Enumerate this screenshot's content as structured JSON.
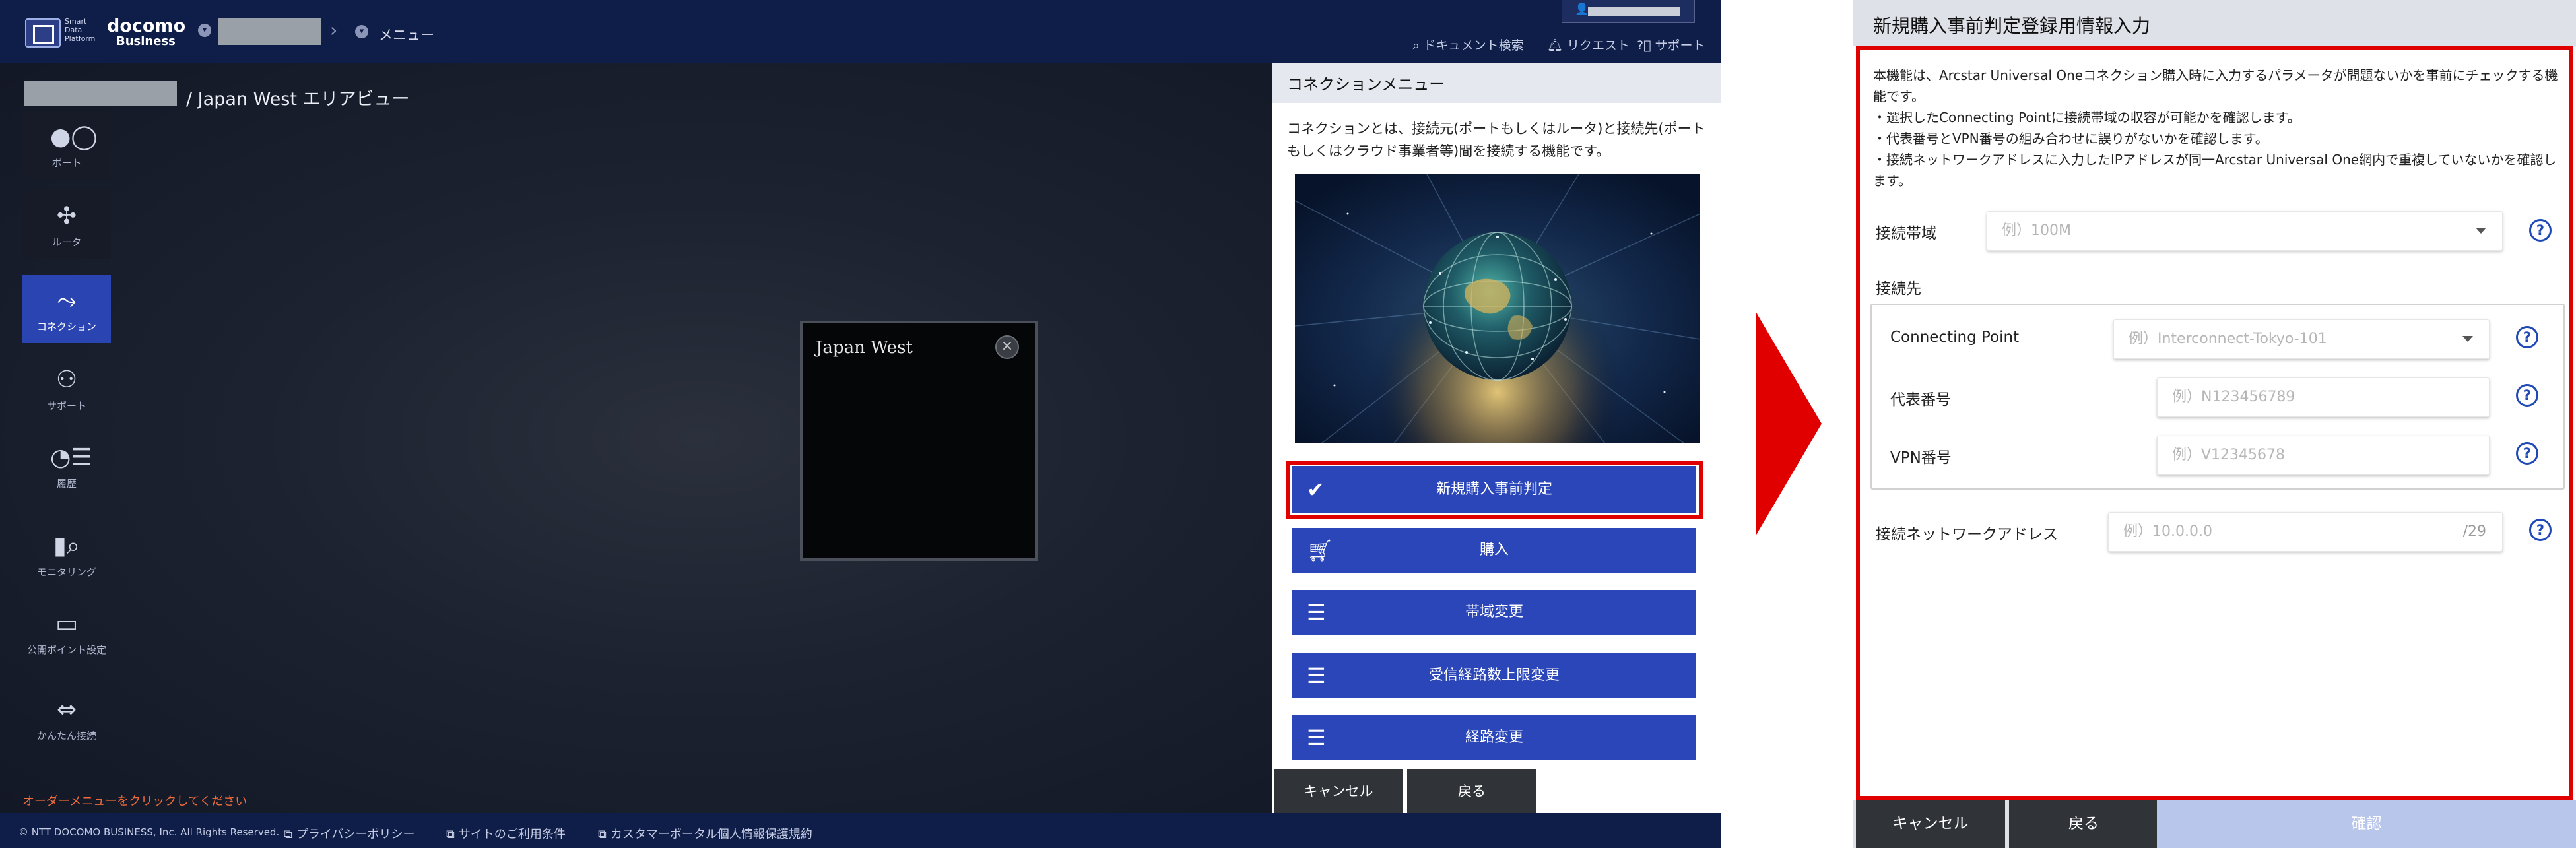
{
  "left": {
    "header": {
      "brand_small": "Smart Data Platform",
      "brand_name": "docomo",
      "brand_sub": "Business",
      "menu_label": "メニュー",
      "links": [
        {
          "label": "ドキュメント検索",
          "icon": "search-icon"
        },
        {
          "label": "リクエスト",
          "icon": "bell-icon"
        },
        {
          "label": "サポート",
          "icon": "help-icon"
        }
      ]
    },
    "area_title": "/ Japan West エリアビュー",
    "sidebar": [
      {
        "label": "ポート",
        "icon": "port-icon"
      },
      {
        "label": "ルータ",
        "icon": "router-icon"
      },
      {
        "label": "コネクション",
        "icon": "connection-icon",
        "active": true
      },
      {
        "label": "サポート",
        "icon": "support-icon"
      },
      {
        "label": "履歴",
        "icon": "history-icon"
      },
      {
        "label": "モニタリング",
        "icon": "monitoring-icon"
      },
      {
        "label": "公開ポイント設定",
        "icon": "public-point-icon"
      },
      {
        "label": "かんたん接続",
        "icon": "easy-connect-icon"
      }
    ],
    "region_card": {
      "title": "Japan West",
      "close": "×"
    },
    "order_hint": "オーダーメニューをクリックしてください",
    "footer": {
      "copyright": "© NTT DOCOMO BUSINESS, Inc. All Rights Reserved.",
      "links": [
        "プライバシーポリシー",
        "サイトのご利用条件",
        "カスタマーポータル個人情報保護規約"
      ]
    },
    "panel": {
      "title": "コネクションメニュー",
      "description": "コネクションとは、接続元(ポートもしくはルータ)と接続先(ポートもしくはクラウド事業者等)間を接続する機能です。",
      "buttons": [
        {
          "label": "新規購入事前判定",
          "icon": "check-circle-icon",
          "highlighted": true
        },
        {
          "label": "購入",
          "icon": "cart-icon"
        },
        {
          "label": "帯域変更",
          "icon": "sliders-icon"
        },
        {
          "label": "受信経路数上限変更",
          "icon": "sliders-icon"
        },
        {
          "label": "経路変更",
          "icon": "sliders-icon"
        }
      ],
      "cancel_label": "キャンセル",
      "back_label": "戻る"
    }
  },
  "right": {
    "title": "新規購入事前判定登録用情報入力",
    "description": [
      "本機能は、Arcstar Universal Oneコネクション購入時に入力するパラメータが問題ないかを事前にチェックする機能です。",
      "・選択したConnecting Pointに接続帯域の収容が可能かを確認します。",
      "・代表番号とVPN番号の組み合わせに誤りがないかを確認します。",
      "・接続ネットワークアドレスに入力したIPアドレスが同一Arcstar Universal One網内で重複していないかを確認します。"
    ],
    "bandwidth": {
      "label": "接続帯域",
      "placeholder": "例）100M"
    },
    "destination_label": "接続先",
    "connecting_point": {
      "label": "Connecting Point",
      "placeholder": "例）Interconnect-Tokyo-101"
    },
    "rep_number": {
      "label": "代表番号",
      "placeholder": "例）N123456789"
    },
    "vpn_number": {
      "label": "VPN番号",
      "placeholder": "例）V12345678"
    },
    "network_address": {
      "label": "接続ネットワークアドレス",
      "placeholder": "例）10.0.0.0",
      "suffix": "/29"
    },
    "cancel_label": "キャンセル",
    "back_label": "戻る",
    "confirm_label": "確認"
  },
  "colors": {
    "header_navy": "#0f1e49",
    "button_blue": "#2a46b8",
    "highlight_red": "#e00000",
    "confirm_disabled": "#b9c6ec"
  }
}
